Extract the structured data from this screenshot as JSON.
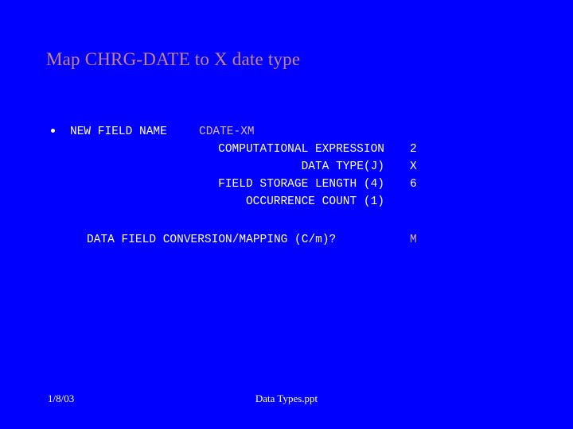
{
  "slide": {
    "background_color": "#0000ff",
    "title": "Map CHRG-DATE to X date type",
    "title_color": "#c28585"
  },
  "body": {
    "bullet": {
      "marker": "bullet-dot",
      "label": "NEW FIELD NAME",
      "value": "CDATE-XM",
      "value_color": "#d8b8d8"
    },
    "fields": [
      {
        "label": "COMPUTATIONAL EXPRESSION",
        "value": "2"
      },
      {
        "label": "DATA TYPE(J)",
        "value": "X"
      },
      {
        "label": "FIELD STORAGE LENGTH (4)",
        "value": "6"
      },
      {
        "label": "OCCURRENCE COUNT (1)",
        "value": ""
      }
    ],
    "conversion": {
      "label": "DATA FIELD CONVERSION/MAPPING (C/m)?",
      "value": "M",
      "value_color": "#d8b8d8"
    },
    "text_color": "#ffffff"
  },
  "footer": {
    "date": "1/8/03",
    "file_name": "Data Types.ppt"
  }
}
